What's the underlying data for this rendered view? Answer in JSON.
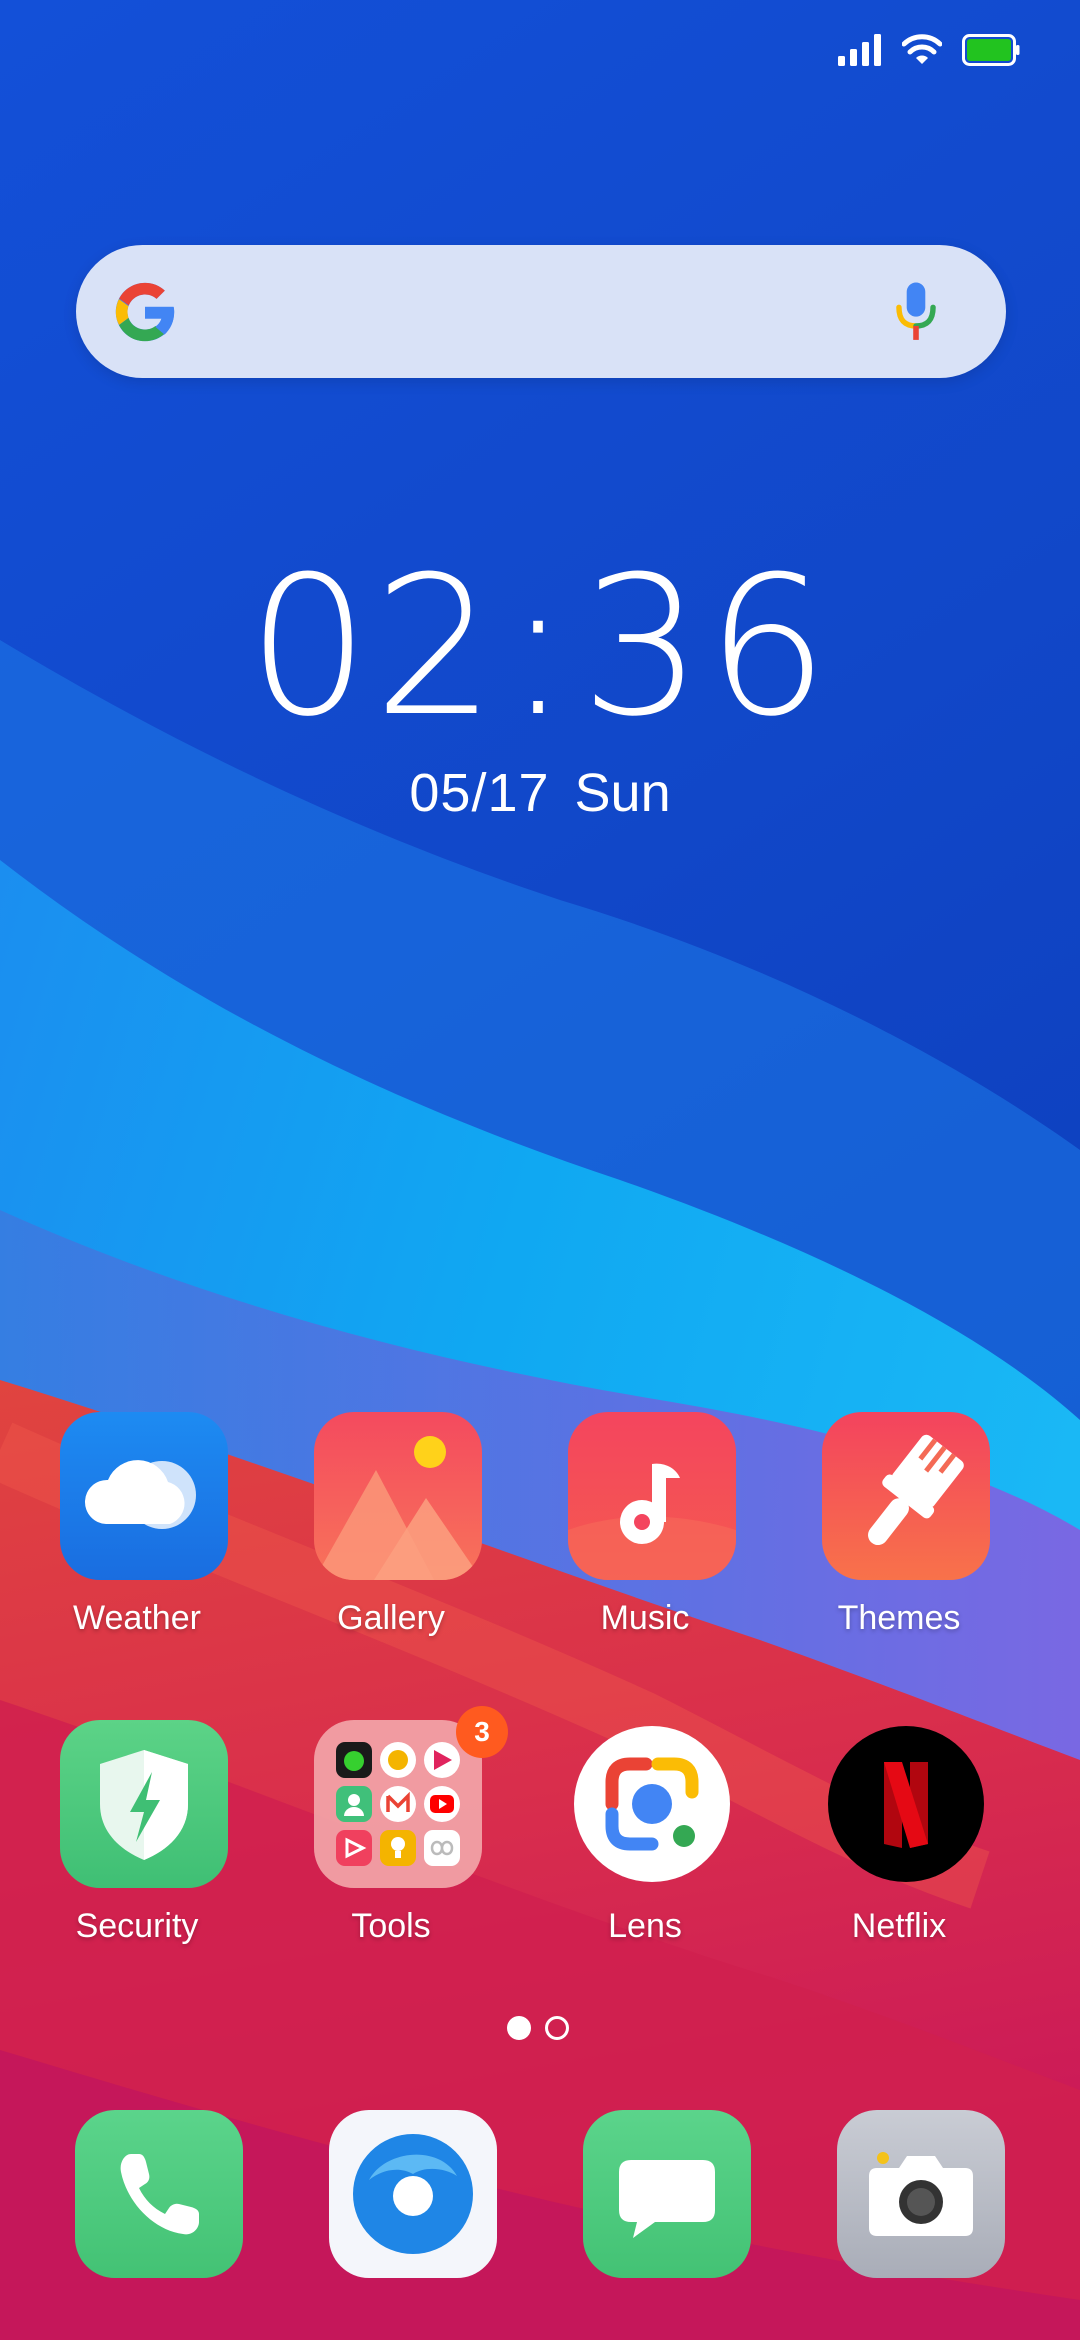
{
  "status_bar": {
    "icons": [
      "signal-icon",
      "wifi-icon",
      "battery-icon"
    ],
    "battery_color": "#22c31f"
  },
  "search": {
    "logo": "google-g-icon",
    "voice_icon": "microphone-icon"
  },
  "clock": {
    "hours": "02",
    "minutes": "36",
    "date": "05/17",
    "weekday": "Sun"
  },
  "apps": {
    "row1": [
      {
        "label": "Weather",
        "icon": "weather-cloud-icon"
      },
      {
        "label": "Gallery",
        "icon": "gallery-mountain-icon"
      },
      {
        "label": "Music",
        "icon": "music-note-icon"
      },
      {
        "label": "Themes",
        "icon": "paint-brush-icon"
      }
    ],
    "row2": [
      {
        "label": "Security",
        "icon": "shield-icon"
      },
      {
        "label": "Tools",
        "icon": "folder-icon",
        "badge": "3"
      },
      {
        "label": "Lens",
        "icon": "lens-icon"
      },
      {
        "label": "Netflix",
        "icon": "netflix-icon"
      }
    ]
  },
  "pages": {
    "count": 2,
    "active": 1
  },
  "dock": [
    {
      "icon": "phone-icon"
    },
    {
      "icon": "browser-icon"
    },
    {
      "icon": "messages-icon"
    },
    {
      "icon": "camera-icon"
    }
  ]
}
